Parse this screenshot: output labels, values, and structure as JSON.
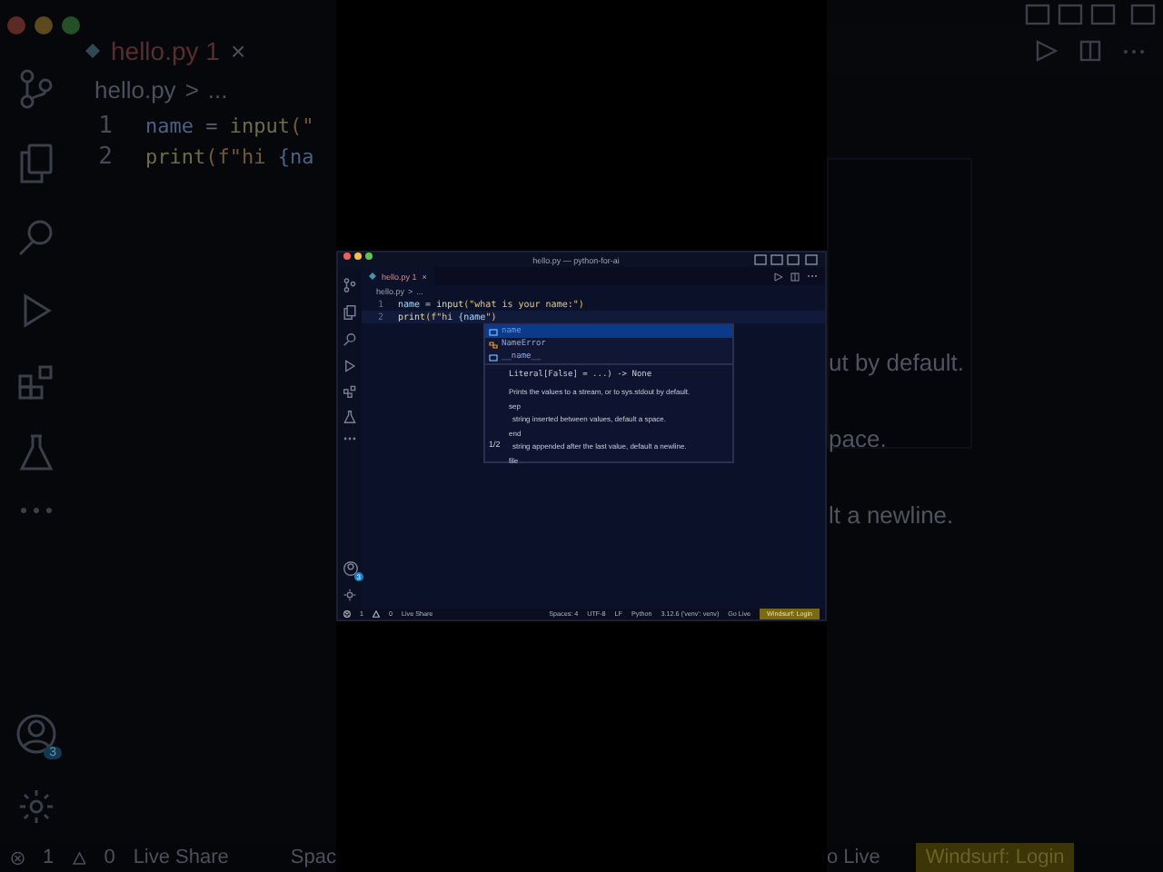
{
  "backdrop_left": {
    "tab": {
      "label": "hello.py",
      "badge": "1",
      "close": "×"
    },
    "breadcrumb": {
      "file": "hello.py",
      "sep": ">",
      "rest": "..."
    },
    "lines": [
      {
        "number": "1",
        "tokens": [
          {
            "text": "name",
            "kind": "var"
          },
          {
            "text": " = ",
            "kind": "op"
          },
          {
            "text": "input",
            "kind": "fn"
          },
          {
            "text": "(\"",
            "kind": "str"
          }
        ]
      },
      {
        "number": "2",
        "tokens": [
          {
            "text": "print",
            "kind": "fn"
          },
          {
            "text": "(",
            "kind": "punct"
          },
          {
            "text": "f\"hi ",
            "kind": "str"
          },
          {
            "text": "{na",
            "kind": "var"
          }
        ]
      }
    ],
    "account_badge": "3",
    "status": {
      "errors": "1",
      "warnings": "0",
      "live_share": "Live Share",
      "spaces": "Spac"
    }
  },
  "window": {
    "title": "hello.py — python-for-ai",
    "tab": {
      "label": "hello.py",
      "badge": "1",
      "close": "×"
    },
    "breadcrumb": {
      "file": "hello.py",
      "sep": ">",
      "rest": "..."
    },
    "lines": [
      {
        "number": "1",
        "tokens": [
          {
            "text": "name",
            "kind": "var"
          },
          {
            "text": " = ",
            "kind": "op"
          },
          {
            "text": "input",
            "kind": "fn"
          },
          {
            "text": "(",
            "kind": "punct"
          },
          {
            "text": "\"what is your name:\"",
            "kind": "str"
          },
          {
            "text": ")",
            "kind": "punct"
          }
        ]
      },
      {
        "number": "2",
        "tokens": [
          {
            "text": "print",
            "kind": "fn"
          },
          {
            "text": "(",
            "kind": "punct"
          },
          {
            "text": "f\"hi ",
            "kind": "str"
          },
          {
            "text": "{name",
            "kind": "var"
          },
          {
            "text": "\")",
            "kind": "str"
          }
        ]
      }
    ],
    "suggestions": [
      {
        "label": "name",
        "kind": "variable",
        "selected": true
      },
      {
        "label": "NameError",
        "kind": "class",
        "selected": false
      },
      {
        "label": "__name__",
        "kind": "variable",
        "selected": false
      }
    ],
    "details": {
      "signature": "Literal[False] = ...) -> None",
      "summary": "Prints the values to a stream, or to sys.stdout by default.",
      "params": [
        {
          "name": "sep",
          "text": "string inserted between values, default a space."
        },
        {
          "name": "end",
          "text": "string appended after the last value, default a newline."
        }
      ],
      "more": "file",
      "pager": "1/2"
    },
    "account_badge": "3",
    "status": {
      "errors": "1",
      "warnings": "0",
      "live_share": "Live Share",
      "spaces": "Spaces: 4",
      "encoding": "UTF-8",
      "eol": "LF",
      "language": "Python",
      "interpreter": "3.12.6 ('venv': venv)",
      "go_live": "Go Live",
      "windsurf": "Windsurf: Login"
    }
  },
  "backdrop_right": {
    "doc_lines": [
      "ut by default.",
      "pace.",
      "lt a newline."
    ],
    "status": {
      "go_live": "o Live",
      "windsurf": "Windsurf: Login"
    }
  }
}
